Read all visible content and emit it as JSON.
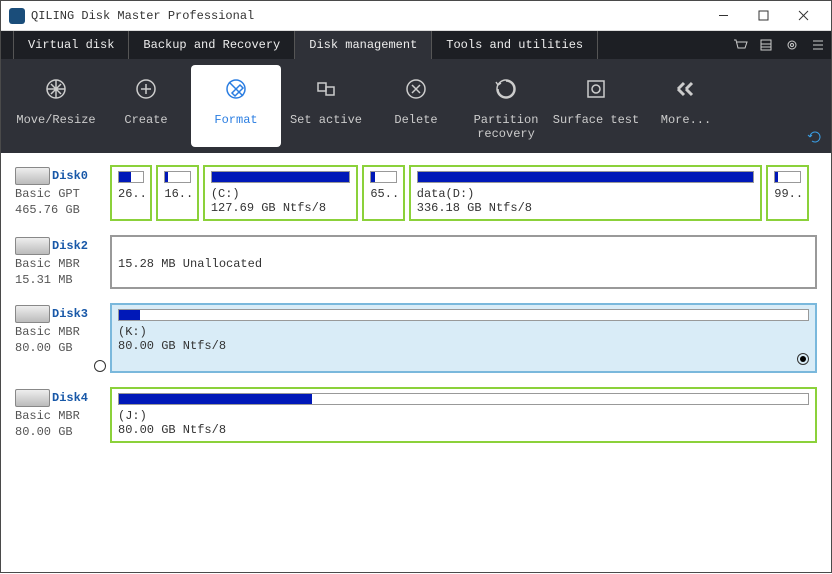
{
  "window": {
    "title": "QILING Disk Master Professional"
  },
  "menu": {
    "tabs": [
      {
        "label": "Virtual disk",
        "active": false
      },
      {
        "label": "Backup and Recovery",
        "active": false
      },
      {
        "label": "Disk management",
        "active": true
      },
      {
        "label": "Tools and utilities",
        "active": false
      }
    ]
  },
  "toolbar": {
    "items": [
      {
        "name": "move-resize",
        "label": "Move/Resize"
      },
      {
        "name": "create",
        "label": "Create"
      },
      {
        "name": "format",
        "label": "Format",
        "active": true
      },
      {
        "name": "set-active",
        "label": "Set active"
      },
      {
        "name": "delete",
        "label": "Delete"
      },
      {
        "name": "partition-recovery",
        "label": "Partition\nrecovery"
      },
      {
        "name": "surface-test",
        "label": "Surface test"
      },
      {
        "name": "more",
        "label": "More..."
      }
    ]
  },
  "disks": [
    {
      "name": "Disk0",
      "type": "Basic GPT",
      "size": "465.76 GB",
      "radio": false,
      "partitions": [
        {
          "label": "",
          "sub": "26...",
          "widthPct": 6,
          "fillPct": 50,
          "style": "alloc"
        },
        {
          "label": "",
          "sub": "16...",
          "widthPct": 6,
          "fillPct": 10,
          "style": "alloc"
        },
        {
          "label": "(C:)",
          "sub": "127.69 GB Ntfs/8",
          "widthPct": 22,
          "fillPct": 100,
          "style": "alloc"
        },
        {
          "label": "",
          "sub": "65...",
          "widthPct": 6,
          "fillPct": 15,
          "style": "alloc"
        },
        {
          "label": "data(D:)",
          "sub": "336.18 GB Ntfs/8",
          "widthPct": 50,
          "fillPct": 100,
          "style": "alloc"
        },
        {
          "label": "",
          "sub": "99...",
          "widthPct": 6,
          "fillPct": 10,
          "style": "alloc"
        }
      ]
    },
    {
      "name": "Disk2",
      "type": "Basic MBR",
      "size": "15.31 MB",
      "radio": false,
      "partitions": [
        {
          "label": "",
          "sub": "15.28 MB Unallocated",
          "widthPct": 100,
          "fillPct": 0,
          "style": "unalloc"
        }
      ]
    },
    {
      "name": "Disk3",
      "type": "Basic MBR",
      "size": "80.00 GB",
      "radio": "empty",
      "partitions": [
        {
          "label": "(K:)",
          "sub": "80.00 GB Ntfs/8",
          "widthPct": 100,
          "fillPct": 3,
          "style": "alloc",
          "selected": true,
          "cornerRadio": "checked"
        }
      ]
    },
    {
      "name": "Disk4",
      "type": "Basic MBR",
      "size": "80.00 GB",
      "radio": false,
      "partitions": [
        {
          "label": "(J:)",
          "sub": "80.00 GB Ntfs/8",
          "widthPct": 100,
          "fillPct": 28,
          "style": "alloc"
        }
      ]
    }
  ]
}
